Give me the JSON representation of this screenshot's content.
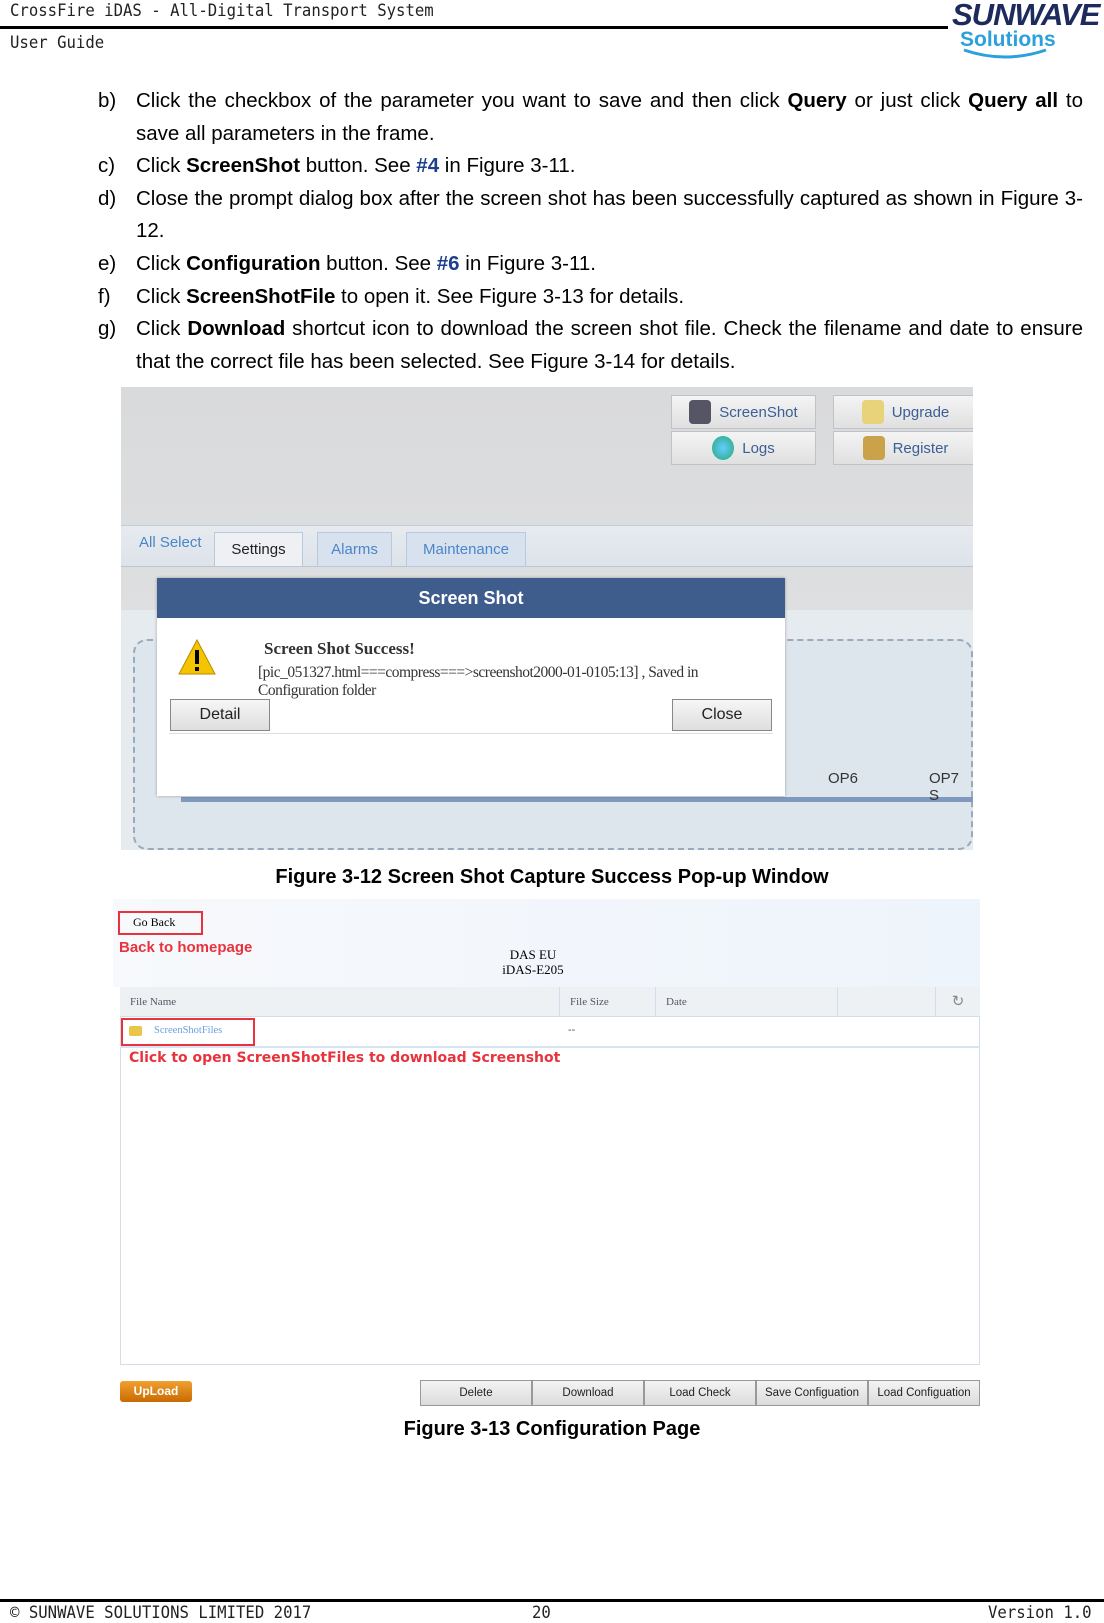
{
  "header": {
    "title": "CrossFire iDAS  - All-Digital Transport System",
    "subtitle": "User Guide",
    "logo_top": "SUNWAVE",
    "logo_bottom": "Solutions"
  },
  "steps": [
    {
      "letter": "b)",
      "parts": [
        {
          "t": "Click the checkbox of the parameter you want to save and then click "
        },
        {
          "b": "Query"
        },
        {
          "t": " or just click "
        },
        {
          "b": "Query all"
        },
        {
          "t": " to save all parameters in the frame."
        }
      ]
    },
    {
      "letter": "c)",
      "parts": [
        {
          "t": "Click "
        },
        {
          "b": "ScreenShot"
        },
        {
          "t": " button. See "
        },
        {
          "h": "#4"
        },
        {
          "t": " in Figure 3-11."
        }
      ]
    },
    {
      "letter": "d)",
      "parts": [
        {
          "t": "Close the prompt dialog box after the screen shot has been successfully captured as shown in Figure 3-12."
        }
      ]
    },
    {
      "letter": "e)",
      "parts": [
        {
          "t": "Click "
        },
        {
          "b": "Configuration"
        },
        {
          "t": " button. See "
        },
        {
          "h": "#6"
        },
        {
          "t": " in Figure 3-11."
        }
      ]
    },
    {
      "letter": "f)",
      "parts": [
        {
          "t": "Click "
        },
        {
          "b": "ScreenShotFile"
        },
        {
          "t": " to open it. See Figure 3-13 for details."
        }
      ]
    },
    {
      "letter": "g)",
      "parts": [
        {
          "t": "Click "
        },
        {
          "b": "Download"
        },
        {
          "t": " shortcut icon to download the screen shot file. Check the filename and date to ensure that the correct file has been selected. See Figure 3-14 for details."
        }
      ]
    }
  ],
  "fig1": {
    "toolbar": {
      "screenshot": "ScreenShot",
      "upgrade": "Upgrade",
      "logs": "Logs",
      "register": "Register"
    },
    "tabs": {
      "all_select": "All Select",
      "settings": "Settings",
      "alarms": "Alarms",
      "maintenance": "Maintenance"
    },
    "dialog": {
      "title": "Screen Shot",
      "heading": "Screen Shot Success!",
      "message": "[pic_051327.html===compress===>screenshot2000-01-0105:13] , Saved in Configuration folder",
      "detail": "Detail",
      "close": "Close"
    },
    "ports": [
      "OP6",
      "OP7 S"
    ],
    "caption": "Figure 3-12 Screen Shot Capture Success Pop-up Window"
  },
  "fig2": {
    "go_back": "Go Back",
    "back_note": "Back to homepage",
    "device_line1": "DAS EU",
    "device_line2": "iDAS-E205",
    "columns": [
      "File Name",
      "File Size",
      "Date"
    ],
    "row": {
      "name": "ScreenShotFiles",
      "size": "--"
    },
    "open_note": "Click to open ScreenShotFiles to download Screenshot",
    "upload": "UpLoad",
    "buttons": [
      "Delete",
      "Download",
      "Load Check",
      "Save Configuation",
      "Load Configuation"
    ],
    "caption": "Figure 3-13 Configuration Page"
  },
  "footer": {
    "copyright": "© SUNWAVE SOLUTIONS LIMITED 2017",
    "page": "20",
    "version": "Version 1.0"
  },
  "colors": {
    "dialog_header": "#3e5c8c",
    "annotation_red": "#e8333d",
    "link_blue": "#4a86c8"
  }
}
